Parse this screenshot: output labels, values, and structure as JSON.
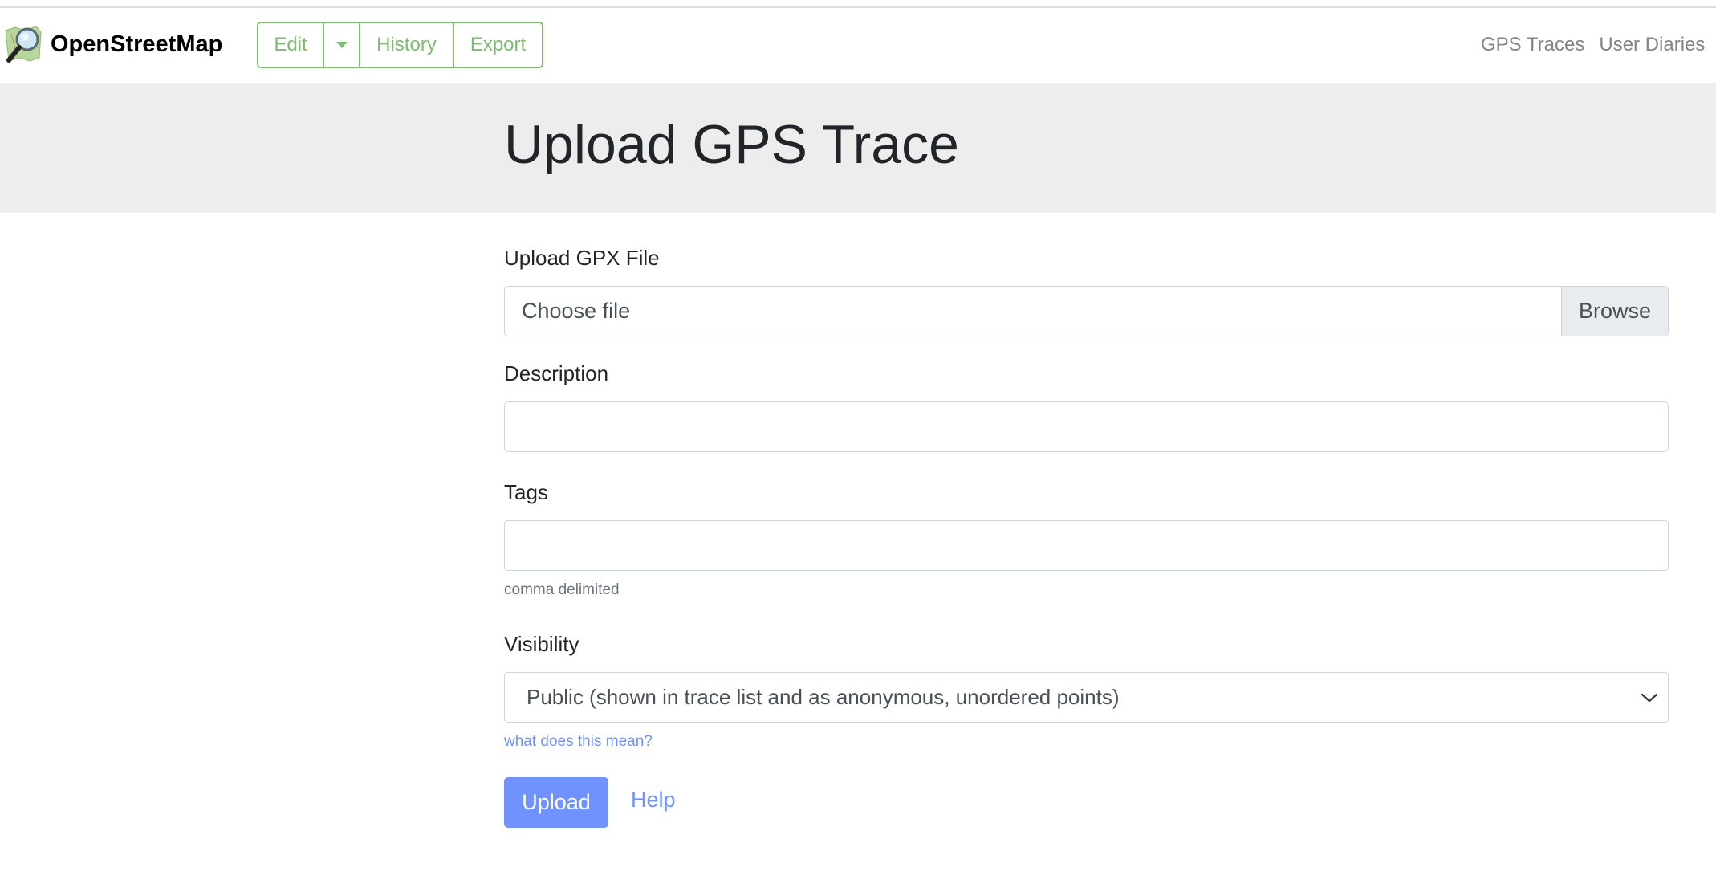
{
  "header": {
    "brand": "OpenStreetMap",
    "logo_icon": "osm-magnifier-map-icon",
    "nav_buttons": {
      "edit": "Edit",
      "edit_dropdown_icon": "caret-down-icon",
      "history": "History",
      "export": "Export"
    },
    "right_links": [
      "GPS Traces",
      "User Diaries"
    ],
    "accent_color": "#7ebc6f"
  },
  "page": {
    "title": "Upload GPS Trace"
  },
  "form": {
    "file": {
      "label": "Upload GPX File",
      "placeholder": "Choose file",
      "browse_label": "Browse"
    },
    "description": {
      "label": "Description",
      "value": ""
    },
    "tags": {
      "label": "Tags",
      "value": "",
      "help": "comma delimited"
    },
    "visibility": {
      "label": "Visibility",
      "selected": "Public (shown in trace list and as anonymous, unordered points)",
      "help_link": "what does this mean?"
    },
    "submit_label": "Upload",
    "help_label": "Help",
    "primary_color": "#7092ff"
  }
}
